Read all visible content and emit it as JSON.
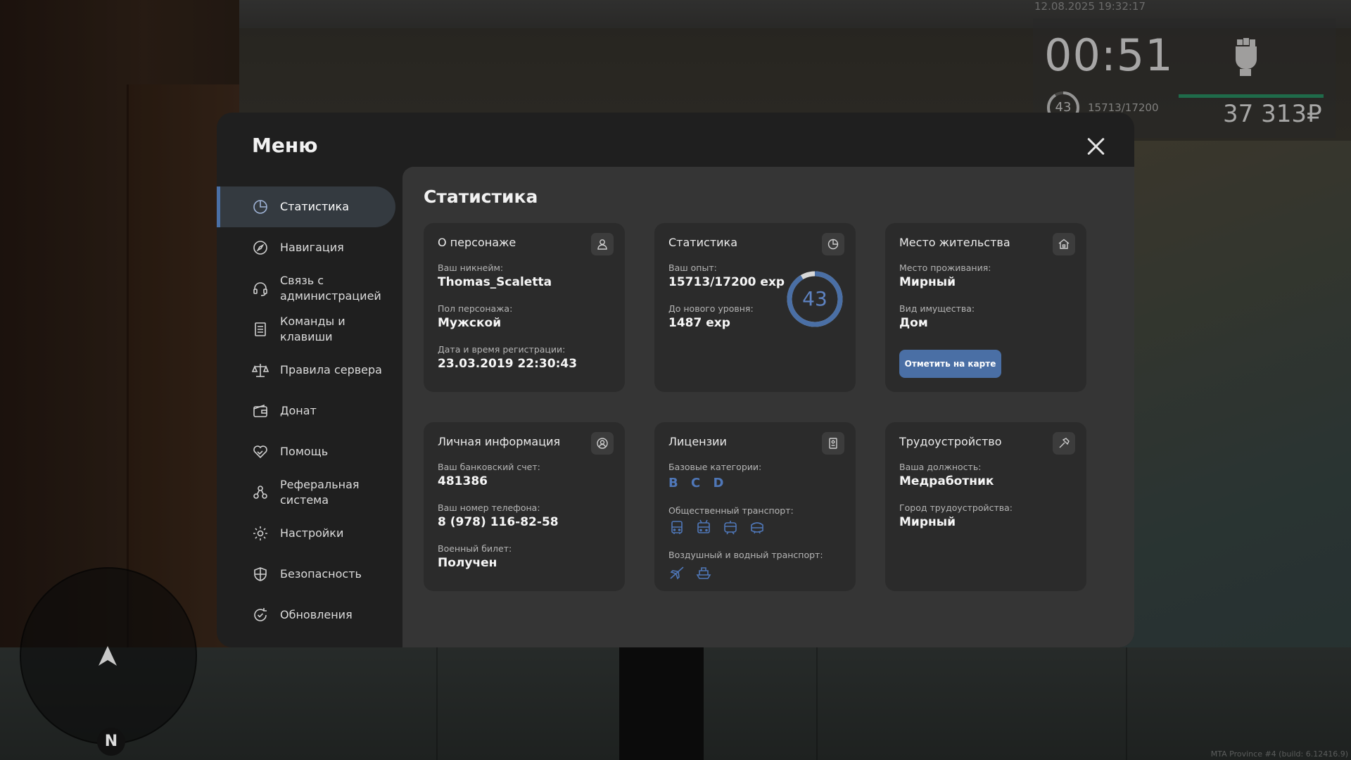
{
  "hud": {
    "date": "12.08.2025 19:32:17",
    "time": "00:51",
    "level": "43",
    "exp": "15713/17200",
    "money": "37 313₽",
    "build": "MTA Province #4 (build: 6.12416.9)",
    "compass": "N"
  },
  "menu": {
    "title": "Меню",
    "sidebar": [
      {
        "label": "Статистика",
        "icon": "pie-chart-icon",
        "active": true
      },
      {
        "label": "Навигация",
        "icon": "compass-icon"
      },
      {
        "label": "Связь с администрацией",
        "icon": "headset-icon"
      },
      {
        "label": "Команды и клавиши",
        "icon": "list-icon"
      },
      {
        "label": "Правила сервера",
        "icon": "scales-icon"
      },
      {
        "label": "Донат",
        "icon": "wallet-icon"
      },
      {
        "label": "Помощь",
        "icon": "handshake-heart-icon"
      },
      {
        "label": "Реферальная система",
        "icon": "referral-icon"
      },
      {
        "label": "Настройки",
        "icon": "gear-icon"
      },
      {
        "label": "Безопасность",
        "icon": "shield-icon"
      },
      {
        "label": "Обновления",
        "icon": "refresh-check-icon"
      }
    ]
  },
  "stats": {
    "title": "Статистика",
    "character": {
      "title": "О персонаже",
      "nick_label": "Ваш никнейм:",
      "nick": "Thomas_Scaletta",
      "gender_label": "Пол персонажа:",
      "gender": "Мужской",
      "reg_label": "Дата и время регистрации:",
      "reg": "23.03.2019 22:30:43"
    },
    "statistics": {
      "title": "Статистика",
      "exp_label": "Ваш опыт:",
      "exp": "15713/17200 exp",
      "next_label": "До нового уровня:",
      "next": "1487 exp",
      "level": "43",
      "progress": 0.9135
    },
    "residence": {
      "title": "Место жительства",
      "place_label": "Место проживания:",
      "place": "Мирный",
      "type_label": "Вид имущества:",
      "type": "Дом",
      "button": "Отметить на карте"
    },
    "personal": {
      "title": "Личная информация",
      "bank_label": "Ваш банковский счет:",
      "bank": "481386",
      "phone_label": "Ваш номер телефона:",
      "phone": "8 (978) 116-82-58",
      "military_label": "Военный билет:",
      "military": "Получен"
    },
    "licenses": {
      "title": "Лицензии",
      "base_label": "Базовые категории:",
      "base": "B C D",
      "public_label": "Общественный транспорт:",
      "air_label": "Воздушный и водный транспорт:"
    },
    "employment": {
      "title": "Трудоустройство",
      "position_label": "Ваша должность:",
      "position": "Медработник",
      "city_label": "Город трудоустройства:",
      "city": "Мирный"
    }
  },
  "colors": {
    "accent": "#4a6fa5",
    "license_blue": "#4f77b8",
    "ring": "#4a6fa5"
  }
}
